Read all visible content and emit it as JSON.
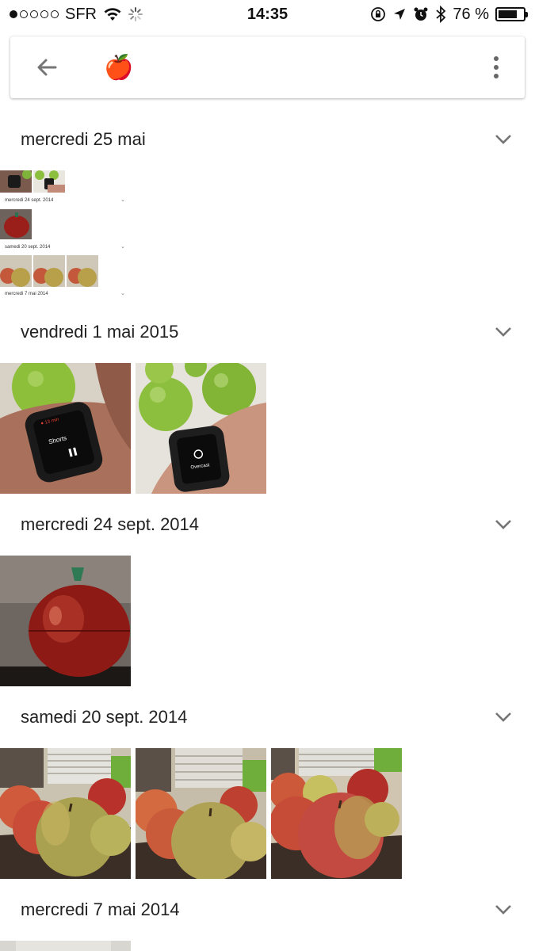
{
  "status_bar": {
    "carrier": "SFR",
    "time": "14:35",
    "battery_text": "76 %",
    "battery_level": 0.76
  },
  "search": {
    "query": "🍎"
  },
  "sections": [
    {
      "title": "mercredi 25 mai"
    },
    {
      "title": "vendredi 1 mai 2015"
    },
    {
      "title": "mercredi 24 sept. 2014"
    },
    {
      "title": "samedi 20 sept. 2014"
    },
    {
      "title": "mercredi 7 mai 2014"
    }
  ],
  "mini_preview": {
    "labels": [
      "mercredi 24 sept. 2014",
      "samedi 20 sept. 2014",
      "mercredi 7 mai 2014"
    ]
  },
  "icons": {
    "back": "back-arrow-icon",
    "more": "more-vert-icon",
    "expand": "chevron-down-icon"
  },
  "colors": {
    "divider": "#e0e0e0",
    "icon_gray": "#757575"
  }
}
